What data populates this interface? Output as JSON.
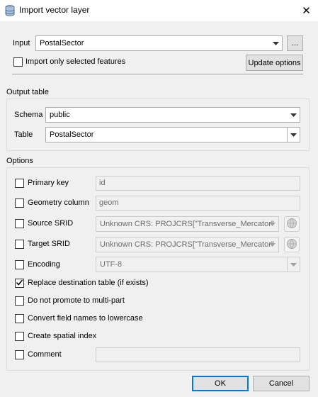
{
  "window": {
    "title": "Import vector layer",
    "close_glyph": "✕"
  },
  "input_section": {
    "label": "Input",
    "value": "PostalSector",
    "browse_label": "...",
    "selected_only_label": "Import only selected features",
    "selected_only_checked": false,
    "update_label": "Update options"
  },
  "output_table": {
    "group_label": "Output table",
    "schema_label": "Schema",
    "schema_value": "public",
    "table_label": "Table",
    "table_value": "PostalSector"
  },
  "options": {
    "group_label": "Options",
    "primary_key": {
      "label": "Primary key",
      "checked": false,
      "value": "id"
    },
    "geometry_column": {
      "label": "Geometry column",
      "checked": false,
      "value": "geom"
    },
    "source_srid": {
      "label": "Source SRID",
      "checked": false,
      "value": "Unknown CRS: PROJCRS[\"Transverse_Mercator\""
    },
    "target_srid": {
      "label": "Target SRID",
      "checked": false,
      "value": "Unknown CRS: PROJCRS[\"Transverse_Mercator\""
    },
    "encoding": {
      "label": "Encoding",
      "checked": false,
      "value": "UTF-8"
    },
    "replace": {
      "label": "Replace destination table (if exists)",
      "checked": true
    },
    "no_multipart": {
      "label": "Do not promote to multi-part",
      "checked": false
    },
    "lowercase": {
      "label": "Convert field names to lowercase",
      "checked": false
    },
    "spatial_index": {
      "label": "Create spatial index",
      "checked": false
    },
    "comment": {
      "label": "Comment",
      "checked": false,
      "value": ""
    }
  },
  "footer": {
    "ok_label": "OK",
    "cancel_label": "Cancel"
  },
  "colors": {
    "window_bg": "#f0f0f0",
    "accent": "#0078d7",
    "checkmark": "#000000"
  },
  "icons": {
    "title": "database-icon",
    "close": "close-icon",
    "crs_select": "globe-icon",
    "combo_arrow": "chevron-down-icon",
    "check": "checkmark-icon"
  }
}
